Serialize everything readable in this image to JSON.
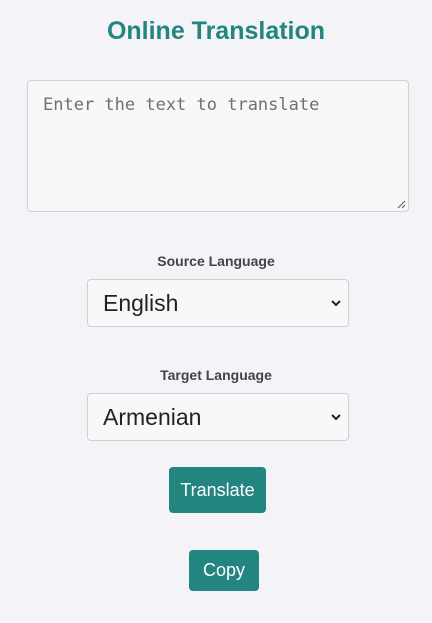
{
  "header": {
    "title": "Online Translation"
  },
  "input": {
    "placeholder": "Enter the text to translate",
    "value": ""
  },
  "source": {
    "label": "Source Language",
    "selected": "English"
  },
  "target": {
    "label": "Target Language",
    "selected": "Armenian"
  },
  "actions": {
    "translate_label": "Translate",
    "copy_label": "Copy"
  },
  "colors": {
    "accent": "#228580",
    "background": "#f3f3f8"
  },
  "icons": {
    "select_arrow": "chevron-down-icon",
    "textarea_grip": "resize-grip-icon"
  }
}
